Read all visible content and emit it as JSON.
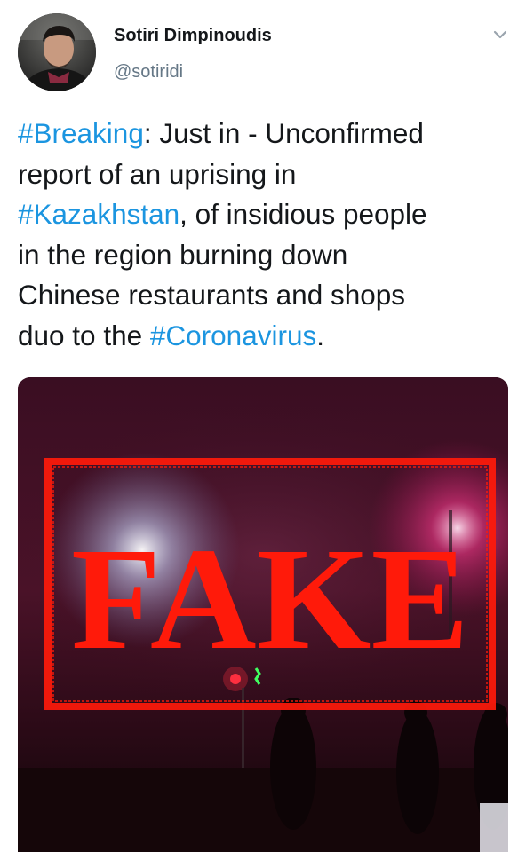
{
  "user": {
    "display_name": "Sotiri Dimpinoudis",
    "handle": "@sotiridi",
    "avatar_icon": "profile-photo"
  },
  "menu": {
    "icon": "chevron-down-icon"
  },
  "tweet": {
    "lines": [
      [
        {
          "text": "#Breaking",
          "tag": true
        },
        {
          "text": ": Just in - Unconfirmed",
          "tag": false
        }
      ],
      [
        {
          "text": "report of an uprising in",
          "tag": false
        }
      ],
      [
        {
          "text": "#Kazakhstan",
          "tag": true
        },
        {
          "text": ", of insidious people",
          "tag": false
        }
      ],
      [
        {
          "text": "in the region burning down",
          "tag": false
        }
      ],
      [
        {
          "text": "Chinese restaurants and shops",
          "tag": false
        }
      ],
      [
        {
          "text": "duo to the ",
          "tag": false
        },
        {
          "text": "#Coronavirus",
          "tag": true
        },
        {
          "text": ".",
          "tag": false
        }
      ]
    ]
  },
  "media": {
    "stamp_text": "FAKE",
    "stamp_color": "#ff1a0a",
    "hashtag_color": "#1b95e0"
  }
}
